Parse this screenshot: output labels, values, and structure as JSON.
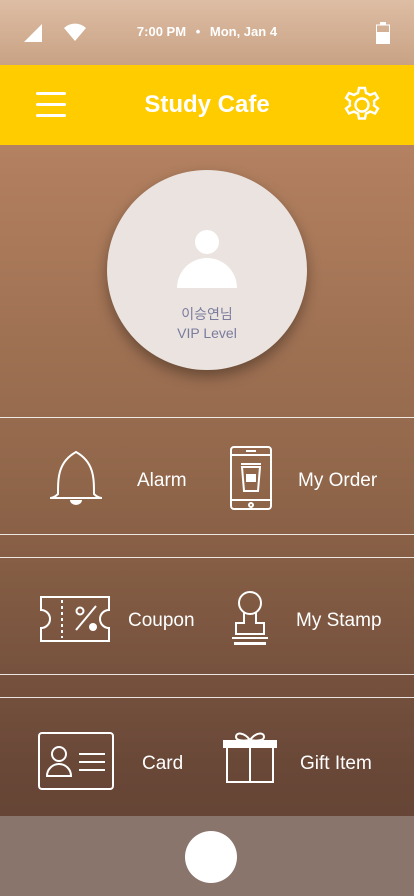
{
  "status_bar": {
    "time": "7:00 PM",
    "separator": "•",
    "date": "Mon, Jan 4",
    "icons": [
      "signal-icon",
      "wifi-icon",
      "battery-icon"
    ]
  },
  "app_bar": {
    "title": "Study Cafe",
    "menu_icon": "hamburger-menu-icon",
    "settings_icon": "gear-icon",
    "background": "#ffcc00"
  },
  "profile": {
    "name": "이승연님",
    "level": "VIP Level",
    "avatar_icon": "person-icon"
  },
  "menu": {
    "alarm": {
      "label": "Alarm",
      "icon": "bell-icon"
    },
    "my_order": {
      "label": "My Order",
      "icon": "phone-coffee-icon"
    },
    "coupon": {
      "label": "Coupon",
      "icon": "coupon-ticket-icon"
    },
    "my_stamp": {
      "label": "My Stamp",
      "icon": "stamp-icon"
    },
    "card": {
      "label": "Card",
      "icon": "id-card-icon"
    },
    "gift_item": {
      "label": "Gift Item",
      "icon": "gift-box-icon"
    }
  },
  "bottom_bar": {
    "home_icon": "home-circle-button"
  },
  "colors": {
    "accent": "#ffcc00",
    "profile_text": "#7a7c9e",
    "bottom_bar": "#8a756d"
  }
}
